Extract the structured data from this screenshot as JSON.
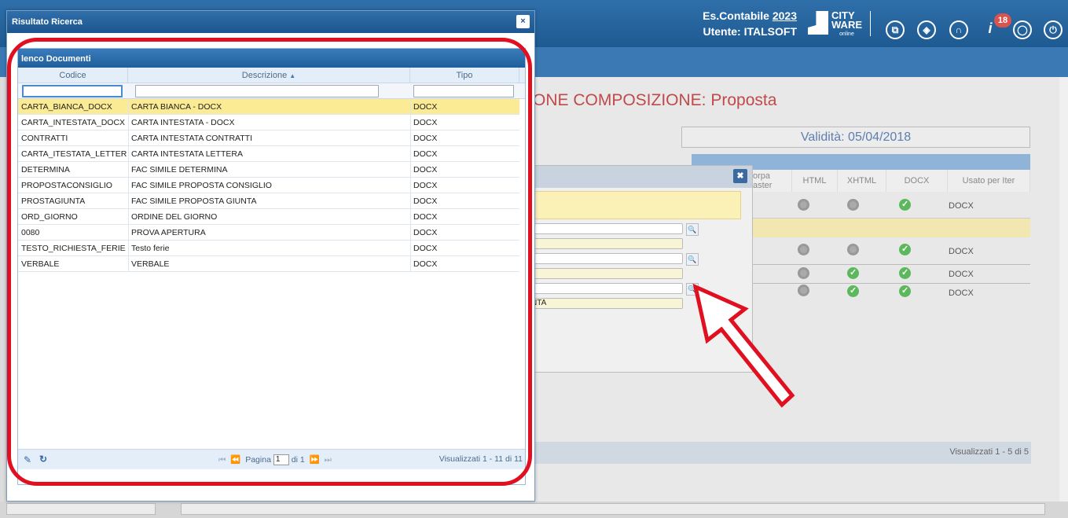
{
  "app": {
    "es_contabile_label": "Es.Contabile",
    "es_contabile_year": "2023",
    "utente_label": "Utente: ITALSOFT",
    "logo_line1": "CITY",
    "logo_line2": "WARE",
    "logo_line3": "online",
    "notification_count": "18",
    "icons": [
      "windows-icon",
      "layers-icon",
      "headset-icon",
      "info-icon",
      "user-icon",
      "power-icon"
    ]
  },
  "background": {
    "page_title": "ONE COMPOSIZIONE: Proposta",
    "validita": "Validità: 05/04/2018",
    "grid_headers": [
      "orpa\naster",
      "HTML",
      "XHTML",
      "DOCX",
      "Usato per Iter"
    ],
    "grid_rows": [
      {
        "html": "off",
        "xhtml": "off",
        "docx": "on",
        "iter": "DOCX"
      },
      {
        "html": "",
        "xhtml": "",
        "docx": "",
        "iter": ""
      },
      {
        "html": "off",
        "xhtml": "off",
        "docx": "on",
        "iter": "DOCX"
      },
      {
        "html": "off",
        "xhtml": "on",
        "docx": "on",
        "iter": "DOCX"
      },
      {
        "html": "off",
        "xhtml": "on",
        "docx": "on",
        "iter": "DOCX"
      }
    ],
    "footer_info": "Visualizzati 1 - 5 di 5",
    "mid_dialog_field_text": "NTA"
  },
  "dialog": {
    "title": "Risultato Ricerca",
    "close_label": "×",
    "panel_title": "lenco Documenti",
    "columns": [
      "Codice",
      "Descrizione",
      "Tipo"
    ],
    "sort_indicator": "▲",
    "rows": [
      {
        "codice": "CARTA_BIANCA_DOCX",
        "descrizione": "CARTA BIANCA - DOCX",
        "tipo": "DOCX",
        "selected": true
      },
      {
        "codice": "CARTA_INTESTATA_DOCX",
        "descrizione": "CARTA INTESTATA - DOCX",
        "tipo": "DOCX"
      },
      {
        "codice": "CONTRATTI",
        "descrizione": "CARTA INTESTATA CONTRATTI",
        "tipo": "DOCX"
      },
      {
        "codice": "CARTA_ITESTATA_LETTERA",
        "descrizione": "CARTA INTESTATA LETTERA",
        "tipo": "DOCX"
      },
      {
        "codice": "DETERMINA",
        "descrizione": "FAC SIMILE DETERMINA",
        "tipo": "DOCX"
      },
      {
        "codice": "PROPOSTACONSIGLIO",
        "descrizione": "FAC SIMILE PROPOSTA CONSIGLIO",
        "tipo": "DOCX"
      },
      {
        "codice": "PROSTAGIUNTA",
        "descrizione": "FAC SIMILE PROPOSTA GIUNTA",
        "tipo": "DOCX"
      },
      {
        "codice": "ORD_GIORNO",
        "descrizione": "ORDINE DEL GIORNO",
        "tipo": "DOCX"
      },
      {
        "codice": "0080",
        "descrizione": "PROVA APERTURA",
        "tipo": "DOCX"
      },
      {
        "codice": "TESTO_RICHIESTA_FERIE",
        "descrizione": "Testo ferie",
        "tipo": "DOCX"
      },
      {
        "codice": "VERBALE",
        "descrizione": "VERBALE",
        "tipo": "DOCX"
      }
    ],
    "pager": {
      "pagina_label": "Pagina",
      "page_value": "1",
      "di_label": "di 1",
      "info": "Visualizzati 1 - 11 di 11"
    }
  },
  "colors": {
    "header_blue": "#1e5a92",
    "selected_row": "#fbeb94",
    "highlight_red": "#e01020"
  }
}
